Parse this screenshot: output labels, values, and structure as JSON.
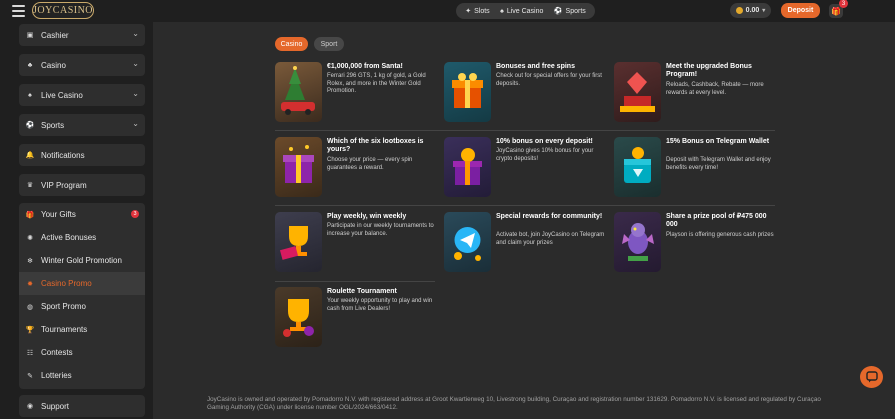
{
  "header": {
    "logo_text": "JOYCASINO",
    "nav": [
      {
        "label": "Slots",
        "icon": "slots-icon"
      },
      {
        "label": "Live Casino",
        "icon": "live-casino-icon"
      },
      {
        "label": "Sports",
        "icon": "sports-icon"
      }
    ],
    "balance": "0.00",
    "deposit_label": "Deposit",
    "gift_count": "3"
  },
  "sidebar": {
    "sections": [
      {
        "label": "Cashier",
        "icon": "wallet-icon"
      },
      {
        "label": "Casino",
        "icon": "casino-icon"
      },
      {
        "label": "Live Casino",
        "icon": "live-casino-icon"
      },
      {
        "label": "Sports",
        "icon": "soccer-ball-icon"
      }
    ],
    "notifications": "Notifications",
    "vip": "VIP Program",
    "group": [
      {
        "label": "Your Gifts",
        "icon": "gift-icon",
        "badge": "3"
      },
      {
        "label": "Active Bonuses",
        "icon": "bonus-icon"
      },
      {
        "label": "Winter Gold Promotion",
        "icon": "snowflake-icon"
      },
      {
        "label": "Casino Promo",
        "icon": "casino-promo-icon",
        "active": true
      },
      {
        "label": "Sport Promo",
        "icon": "sport-promo-icon"
      },
      {
        "label": "Tournaments",
        "icon": "trophy-icon"
      },
      {
        "label": "Contests",
        "icon": "contests-icon"
      },
      {
        "label": "Lotteries",
        "icon": "lottery-icon"
      }
    ],
    "support": "Support"
  },
  "tabs": [
    {
      "label": "Casino",
      "active": true
    },
    {
      "label": "Sport",
      "active": false
    }
  ],
  "promos": [
    {
      "title": "€1,000,000 from Santa!",
      "desc": "Ferrari 296 GTS, 1 kg of gold, a Gold Rolex, and more in the Winter Gold Promotion.",
      "art": "santa-car"
    },
    {
      "title": "Bonuses and free spins",
      "desc": "Check out for special offers for your first deposits.",
      "art": "gift-box"
    },
    {
      "title": "Meet the upgraded Bonus Program!",
      "desc": "Reloads, Cashback, Rebate — more rewards at every level.",
      "art": "diamond-podium"
    },
    {
      "title": "Which of the six lootboxes is yours?",
      "desc": "Choose your price — every spin guarantees a reward.",
      "art": "lootbox"
    },
    {
      "title": "10% bonus on every deposit!",
      "desc": "JoyCasino gives 10% bonus for your crypto deposits!",
      "art": "coin-box"
    },
    {
      "title": "15% Bonus on Telegram Wallet",
      "desc": "Deposit with Telegram Wallet and enjoy benefits every time!",
      "art": "wallet-chest"
    },
    {
      "title": "Play weekly, win weekly",
      "desc": "Participate in our weekly tournaments to increase your balance.",
      "art": "trophy-ticket"
    },
    {
      "title": "Special rewards for community!",
      "desc": "Activate bot, join JoyCasino on Telegram and claim your prizes",
      "art": "telegram"
    },
    {
      "title": "Share a prize pool of ₽475 000 000",
      "desc": "Playson is offering generous cash prizes",
      "art": "dragon"
    },
    {
      "title": "Roulette Tournament",
      "desc": "Your weekly opportunity to play and win cash from Live Dealers!",
      "art": "trophy-chips"
    }
  ],
  "footer": "JoyCasino is owned and operated by Pomadorro N.V. with registered address at Groot Kwartierweg 10, Livestrong building, Curaçao and registration number 131629. Pomadorro N.V. is licensed and regulated by Curaçao Gaming Authority (CGA) under license number OGL/2024/663/0412."
}
